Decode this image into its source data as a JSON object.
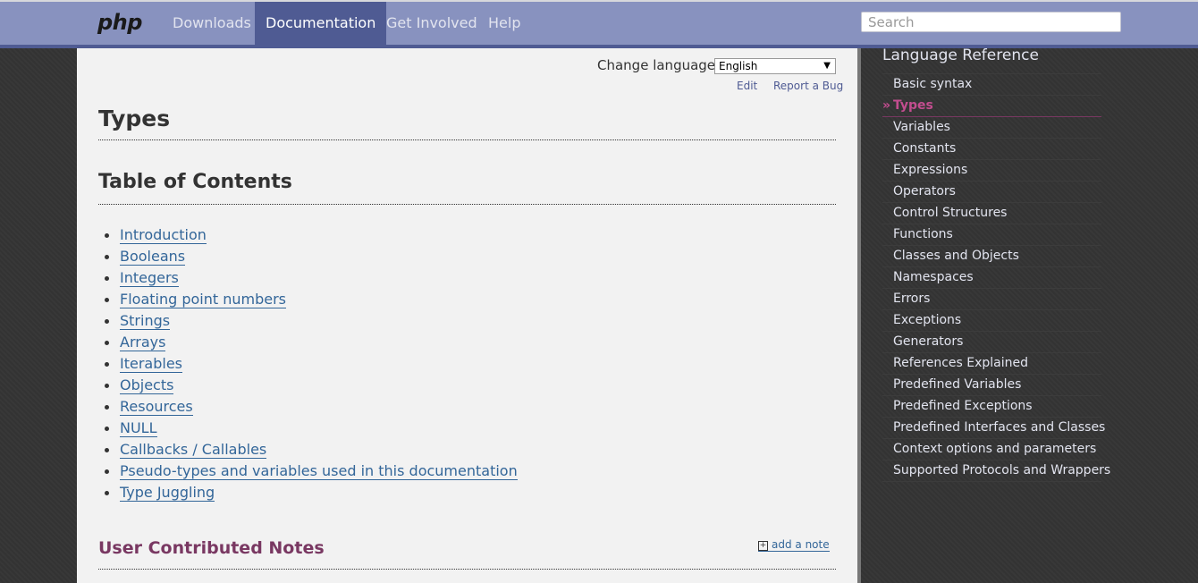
{
  "nav": {
    "logo": "php",
    "items": [
      {
        "label": "Downloads",
        "active": false
      },
      {
        "label": "Documentation",
        "active": true
      },
      {
        "label": "Get Involved",
        "active": false
      },
      {
        "label": "Help",
        "active": false
      }
    ],
    "search_placeholder": "Search"
  },
  "page": {
    "change_language_label": "Change language:",
    "language_selected": "English",
    "edit_label": "Edit",
    "report_bug_label": "Report a Bug",
    "title": "Types",
    "toc_heading": "Table of Contents",
    "toc": [
      "Introduction",
      "Booleans",
      "Integers",
      "Floating point numbers",
      "Strings",
      "Arrays",
      "Iterables",
      "Objects",
      "Resources",
      "NULL",
      "Callbacks / Callables",
      "Pseudo-types and variables used in this documentation",
      "Type Juggling"
    ],
    "notes_heading": "User Contributed Notes",
    "add_note_label": "add a note",
    "add_note_icon": "plus-box-icon"
  },
  "sidebar": {
    "title": "Language Reference",
    "current_marker": "»",
    "items": [
      {
        "label": "Basic syntax",
        "current": false
      },
      {
        "label": "Types",
        "current": true
      },
      {
        "label": "Variables",
        "current": false
      },
      {
        "label": "Constants",
        "current": false
      },
      {
        "label": "Expressions",
        "current": false
      },
      {
        "label": "Operators",
        "current": false
      },
      {
        "label": "Control Structures",
        "current": false
      },
      {
        "label": "Functions",
        "current": false
      },
      {
        "label": "Classes and Objects",
        "current": false
      },
      {
        "label": "Namespaces",
        "current": false
      },
      {
        "label": "Errors",
        "current": false
      },
      {
        "label": "Exceptions",
        "current": false
      },
      {
        "label": "Generators",
        "current": false
      },
      {
        "label": "References Explained",
        "current": false
      },
      {
        "label": "Predefined Variables",
        "current": false
      },
      {
        "label": "Predefined Exceptions",
        "current": false
      },
      {
        "label": "Predefined Interfaces and Classes",
        "current": false
      },
      {
        "label": "Context options and parameters",
        "current": false
      },
      {
        "label": "Supported Protocols and Wrappers",
        "current": false
      }
    ]
  },
  "colors": {
    "nav_bg": "#8892bf",
    "nav_active": "#4f5b93",
    "link": "#336699",
    "notes_heading": "#793862",
    "sidebar_current": "#c34d8f"
  }
}
